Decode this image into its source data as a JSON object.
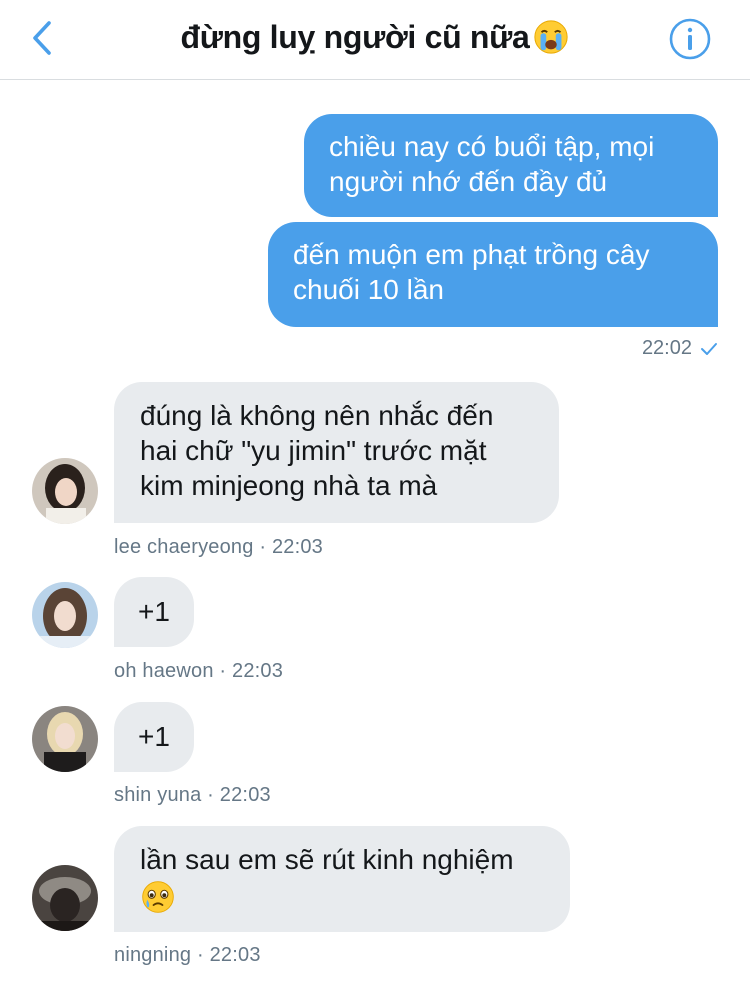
{
  "header": {
    "title": "đừng luỵ người cũ nữa",
    "title_emoji": "crying-face-emoji"
  },
  "messages_out": [
    {
      "text": "chiều nay có buổi tập, mọi người nhớ đến đầy đủ"
    },
    {
      "text": "đến muộn em phạt trồng cây chuối 10 lần"
    }
  ],
  "out_meta": {
    "time": "22:02",
    "status_icon": "check-icon"
  },
  "messages_in": [
    {
      "sender": "lee chaeryeong",
      "time": "22:03",
      "text": "đúng là không nên nhắc đến hai chữ \"yu jimin\" trước mặt kim minjeong nhà ta mà",
      "meta": "lee chaeryeong · 22:03"
    },
    {
      "sender": "oh haewon",
      "time": "22:03",
      "text": "+1",
      "meta": "oh haewon · 22:03"
    },
    {
      "sender": "shin yuna",
      "time": "22:03",
      "text": "+1",
      "meta": "shin yuna · 22:03"
    },
    {
      "sender": "ningning",
      "time": "22:03",
      "text": "lần sau em sẽ rút kinh nghiệm",
      "emoji": "holding-back-tears-emoji",
      "meta": "ningning · 22:03"
    }
  ],
  "colors": {
    "accent": "#4a9fea",
    "incoming_bubble": "#e8ebee",
    "meta_text": "#657786"
  }
}
